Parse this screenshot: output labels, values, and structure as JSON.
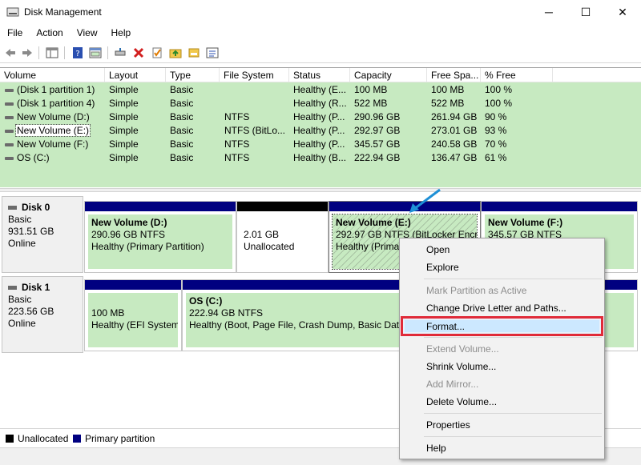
{
  "window": {
    "title": "Disk Management",
    "minimize_glyph": "─",
    "maximize_glyph": "☐",
    "close_glyph": "✕"
  },
  "menu": [
    "File",
    "Action",
    "View",
    "Help"
  ],
  "toolbar_icons": [
    "back-arrow-icon",
    "forward-arrow-icon",
    "console-tree-icon",
    "help-icon",
    "properties-icon",
    "connect-icon",
    "delete-icon",
    "check-icon",
    "folder-up-icon",
    "list-icon"
  ],
  "columns": [
    "Volume",
    "Layout",
    "Type",
    "File System",
    "Status",
    "Capacity",
    "Free Spa...",
    "% Free"
  ],
  "volumes": [
    {
      "volume": "(Disk 1 partition 1)",
      "layout": "Simple",
      "type": "Basic",
      "fs": "",
      "status": "Healthy (E...",
      "capacity": "100 MB",
      "free": "100 MB",
      "pct": "100 %"
    },
    {
      "volume": "(Disk 1 partition 4)",
      "layout": "Simple",
      "type": "Basic",
      "fs": "",
      "status": "Healthy (R...",
      "capacity": "522 MB",
      "free": "522 MB",
      "pct": "100 %"
    },
    {
      "volume": "New Volume (D:)",
      "layout": "Simple",
      "type": "Basic",
      "fs": "NTFS",
      "status": "Healthy (P...",
      "capacity": "290.96 GB",
      "free": "261.94 GB",
      "pct": "90 %"
    },
    {
      "volume": "New Volume (E:)",
      "layout": "Simple",
      "type": "Basic",
      "fs": "NTFS (BitLo...",
      "status": "Healthy (P...",
      "capacity": "292.97 GB",
      "free": "273.01 GB",
      "pct": "93 %"
    },
    {
      "volume": "New Volume (F:)",
      "layout": "Simple",
      "type": "Basic",
      "fs": "NTFS",
      "status": "Healthy (P...",
      "capacity": "345.57 GB",
      "free": "240.58 GB",
      "pct": "70 %"
    },
    {
      "volume": "OS (C:)",
      "layout": "Simple",
      "type": "Basic",
      "fs": "NTFS",
      "status": "Healthy (B...",
      "capacity": "222.94 GB",
      "free": "136.47 GB",
      "pct": "61 %"
    }
  ],
  "disks": [
    {
      "name": "Disk 0",
      "type": "Basic",
      "size": "931.51 GB",
      "state": "Online",
      "partitions": [
        {
          "name": "New Volume  (D:)",
          "line1": "290.96 GB NTFS",
          "line2": "Healthy (Primary Partition)"
        },
        {
          "name": "",
          "line1": "2.01 GB",
          "line2": "Unallocated"
        },
        {
          "name": "New Volume  (E:)",
          "line1": "292.97 GB NTFS (BitLocker Encryp",
          "line2": "Healthy (Prima"
        },
        {
          "name": "New Volume  (F:)",
          "line1": "345.57 GB NTFS",
          "line2": ""
        }
      ]
    },
    {
      "name": "Disk 1",
      "type": "Basic",
      "size": "223.56 GB",
      "state": "Online",
      "partitions": [
        {
          "name": "",
          "line1": "100 MB",
          "line2": "Healthy (EFI System"
        },
        {
          "name": "OS  (C:)",
          "line1": "222.94 GB NTFS",
          "line2": "Healthy (Boot, Page File, Crash Dump, Basic Data"
        }
      ]
    }
  ],
  "legend": [
    {
      "label": "Unallocated",
      "color": "#000000"
    },
    {
      "label": "Primary partition",
      "color": "#000080"
    }
  ],
  "context_menu": [
    {
      "label": "Open",
      "enabled": true
    },
    {
      "label": "Explore",
      "enabled": true
    },
    {
      "label": "Mark Partition as Active",
      "enabled": false
    },
    {
      "label": "Change Drive Letter and Paths...",
      "enabled": true
    },
    {
      "label": "Format...",
      "enabled": true,
      "highlighted": true
    },
    {
      "label": "Extend Volume...",
      "enabled": false
    },
    {
      "label": "Shrink Volume...",
      "enabled": true
    },
    {
      "label": "Add Mirror...",
      "enabled": false
    },
    {
      "label": "Delete Volume...",
      "enabled": true
    },
    {
      "label": "Properties",
      "enabled": true
    },
    {
      "label": "Help",
      "enabled": true
    }
  ],
  "colors": {
    "healthy_fill": "#c7eac1",
    "primary_bar": "#000080",
    "unallocated_bar": "#000000",
    "highlight_box": "#e02b39",
    "pointer_arrow": "#1e90d6"
  }
}
